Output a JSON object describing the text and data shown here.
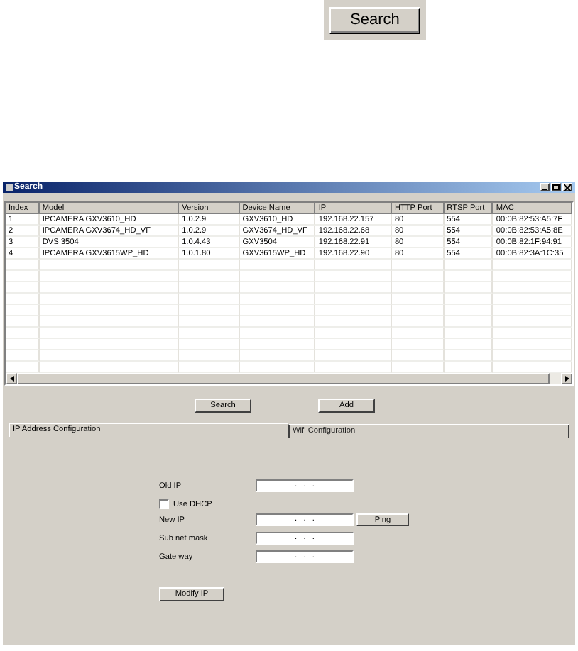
{
  "top_button": "Search",
  "window": {
    "title": "Search"
  },
  "table": {
    "columns": [
      "Index",
      "Model",
      "Version",
      "Device Name",
      "IP",
      "HTTP Port",
      "RTSP Port",
      "MAC"
    ],
    "rows": [
      [
        "1",
        "IPCAMERA GXV3610_HD",
        "1.0.2.9",
        "GXV3610_HD",
        "192.168.22.157",
        "80",
        "554",
        "00:0B:82:53:A5:7F"
      ],
      [
        "2",
        "IPCAMERA GXV3674_HD_VF",
        "1.0.2.9",
        "GXV3674_HD_VF",
        "192.168.22.68",
        "80",
        "554",
        "00:0B:82:53:A5:8E"
      ],
      [
        "3",
        "DVS 3504",
        "1.0.4.43",
        "GXV3504",
        "192.168.22.91",
        "80",
        "554",
        "00:0B:82:1F:94:91"
      ],
      [
        "4",
        "IPCAMERA GXV3615WP_HD",
        "1.0.1.80",
        "GXV3615WP_HD",
        "192.168.22.90",
        "80",
        "554",
        "00:0B:82:3A:1C:35"
      ]
    ]
  },
  "buttons": [
    "Search",
    "Add"
  ],
  "tabs": [
    {
      "label": "IP Address Configuration",
      "selected": true
    },
    {
      "label": "Wifi Configuration",
      "selected": false
    }
  ],
  "form": {
    "old_ip": {
      "label": "Old IP",
      "value": ".   .   ."
    },
    "use_dhcp": {
      "label": "Use DHCP",
      "checked": false
    },
    "new_ip": {
      "label": "New IP",
      "value": ".   .   ."
    },
    "ping_button": "Ping",
    "subnet_mask": {
      "label": "Sub net mask",
      "value": ".   .   ."
    },
    "gateway": {
      "label": "Gate way",
      "value": ".   .   ."
    },
    "modify_button": "Modify IP"
  }
}
